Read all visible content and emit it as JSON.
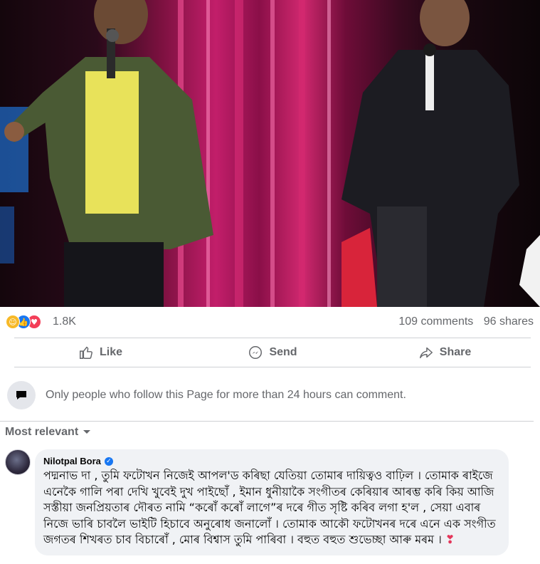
{
  "post": {
    "photo_alt": "",
    "reactions": {
      "icons": [
        "haha",
        "like",
        "love"
      ],
      "count": "1.8K",
      "comments": "109 comments",
      "shares": "96 shares"
    },
    "actions": {
      "like_label": "Like",
      "send_label": "Send",
      "share_label": "Share"
    },
    "comment_gate": "Only people who follow this Page for more than 24 hours can comment.",
    "sort_label": "Most relevant"
  },
  "comment": {
    "author": "Nilotpal Bora",
    "text": "পদ্মনাভ দা , তুমি ফটোখন নিজেই আপল'ড কৰিছা যেতিয়া তোমাৰ দায়িত্বও বাঢ়িল । তোমাক ৰাইজে এনেকৈ গালি পৰা দেখি খুবেই দুখ পাইছোঁ , ইমান ধুনীয়াকৈ সংগীতৰ কেৰিয়াৰ আৰম্ভ কৰি কিয় আজি সস্তীয়া জনপ্ৰিয়তাৰ দৌৰত নামি “কৰোঁ কৰোঁ লাগে”ৰ দৰে গীত সৃষ্টি কৰিব লগা হ'ল , সেয়া এবাৰ নিজে ভাৰি চাবলৈ ভাইটি হিচাবে অনুৰোধ জনালোঁ । তোমাক আকৌ ফটোখনৰ দৰে এনে এক সংগীত জগতৰ শিখৰত চাব বিচাৰোঁ , মোৰ বিশ্বাস তুমি পাৰিবা । বহুত বহুত শুভেচ্ছা আৰু মৰম ।",
    "emoji": "❣"
  },
  "colors": {
    "muted": "#65676b",
    "like_blue": "#1877f2",
    "love_red": "#f33e58",
    "haha_yellow": "#f7b928",
    "bubble_bg": "#f0f2f5"
  }
}
